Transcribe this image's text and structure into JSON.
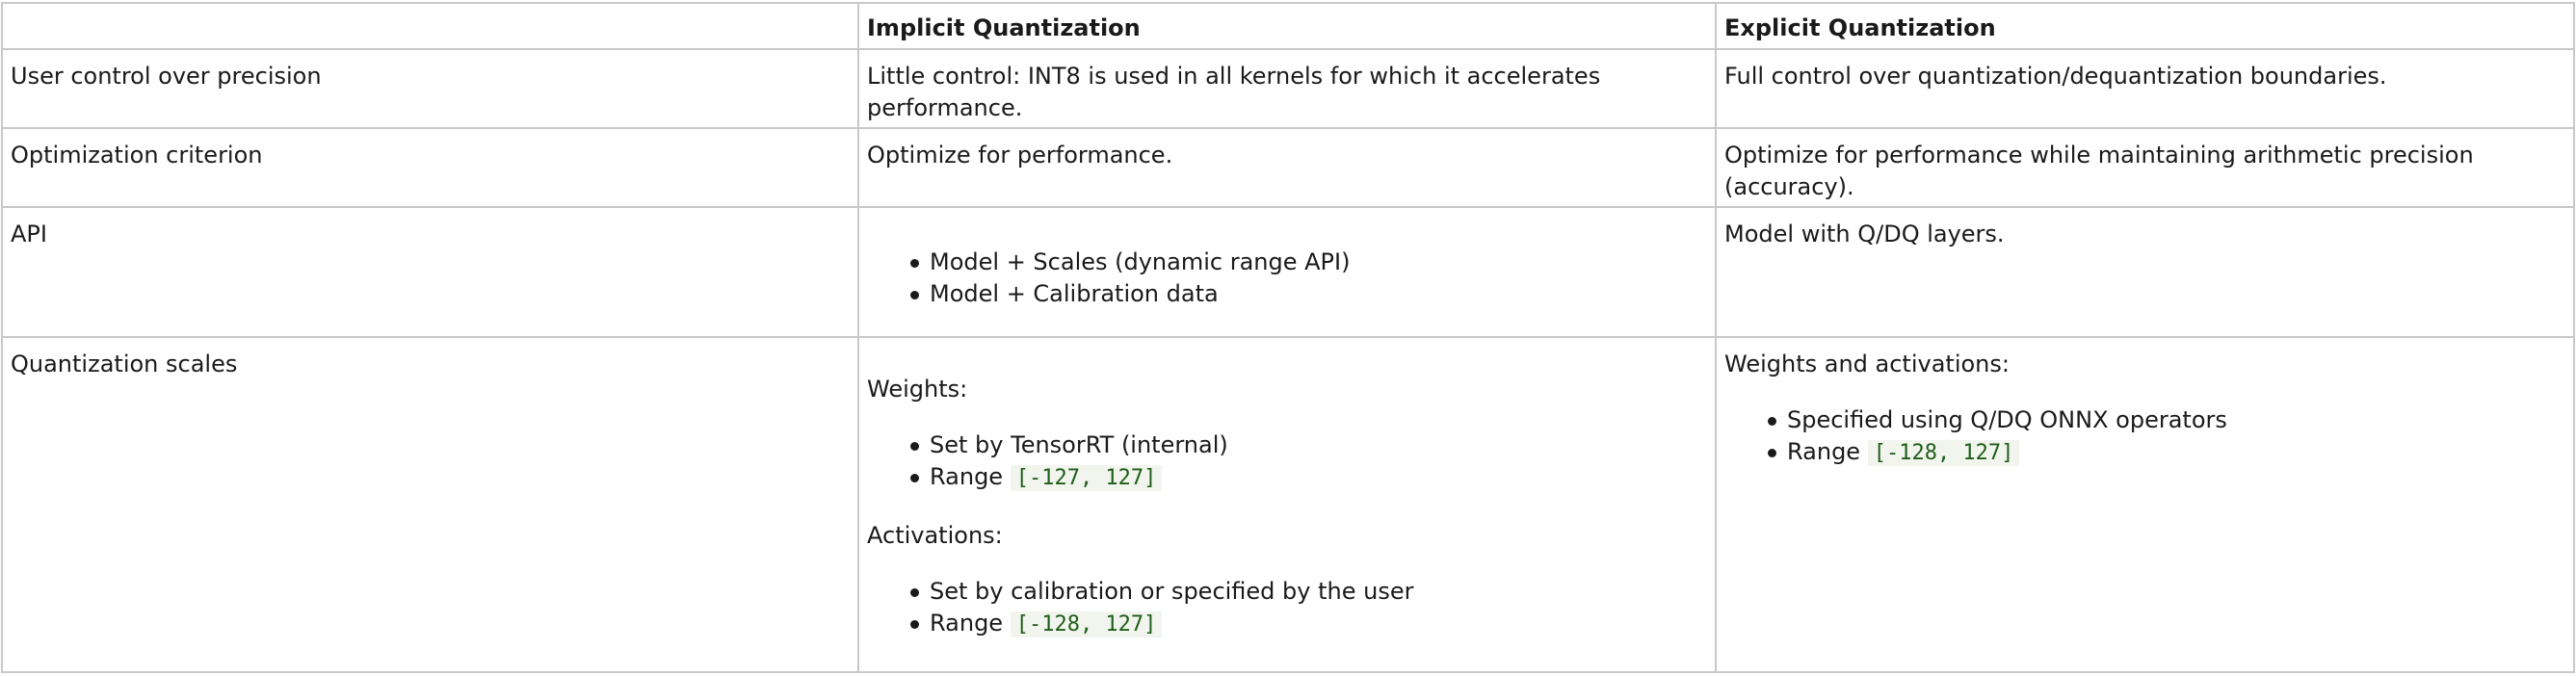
{
  "table": {
    "headers": [
      "",
      "Implicit Quantization",
      "Explicit Quantization"
    ],
    "rows": {
      "control": {
        "label": "User control over precision",
        "implicit": "Little control: INT8 is used in all kernels for which it accelerates performance.",
        "explicit": "Full control over quantization/dequantization boundaries."
      },
      "criterion": {
        "label": "Optimization criterion",
        "implicit": "Optimize for performance.",
        "explicit": "Optimize for performance while maintaining arithmetic precision (accuracy)."
      },
      "api": {
        "label": "API",
        "implicit_items": [
          "Model + Scales (dynamic range API)",
          "Model + Calibration data"
        ],
        "explicit": "Model with Q/DQ layers."
      },
      "scales": {
        "label": "Quantization scales",
        "implicit": {
          "weights_heading": "Weights:",
          "weights_item1": "Set by TensorRT (internal)",
          "weights_range_label": "Range",
          "weights_range_code": "[-127, 127]",
          "activations_heading": "Activations:",
          "activations_item1": "Set by calibration or specified by the user",
          "activations_range_label": "Range",
          "activations_range_code": "[-128, 127]"
        },
        "explicit": {
          "heading": "Weights and activations:",
          "item1": "Specified using Q/DQ ONNX operators",
          "range_label": "Range",
          "range_code": "[-128, 127]"
        }
      }
    }
  }
}
